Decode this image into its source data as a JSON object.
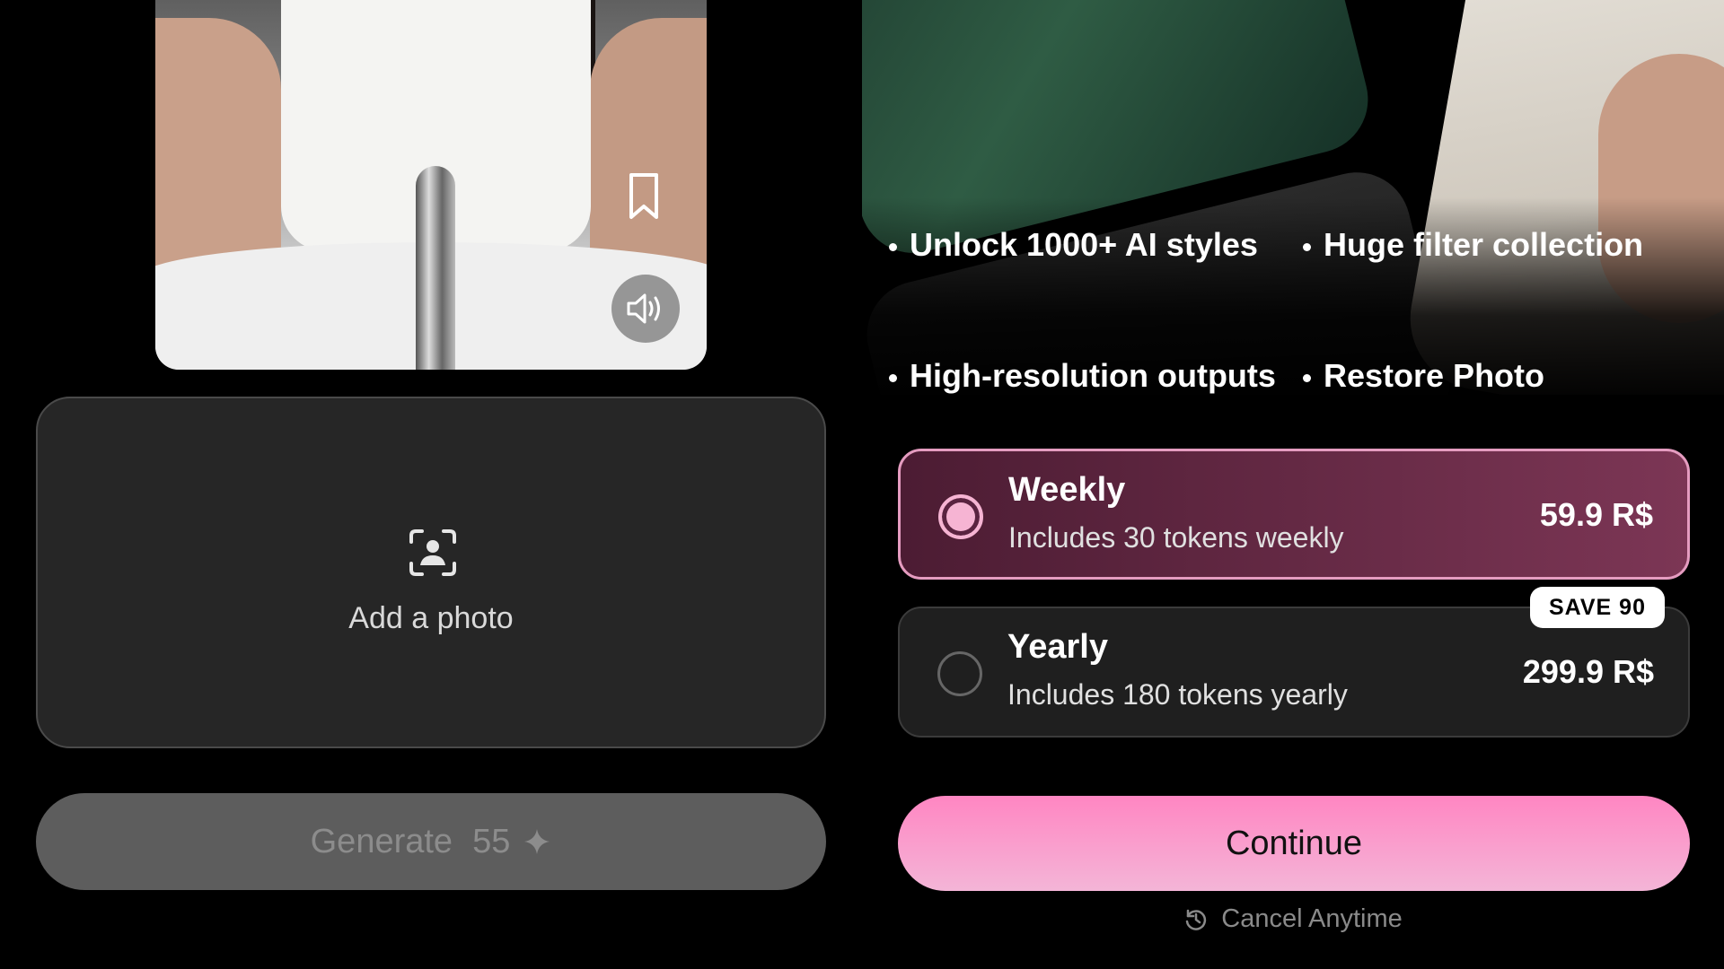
{
  "left": {
    "add_photo_label": "Add a photo",
    "generate_label": "Generate",
    "generate_cost": "55"
  },
  "right": {
    "features": [
      "Unlock 1000+ AI styles",
      "Huge filter collection",
      "High-resolution outputs",
      "Restore Photo"
    ],
    "plans": [
      {
        "name": "Weekly",
        "description": "Includes 30 tokens weekly",
        "price": "59.9 R$",
        "selected": true
      },
      {
        "name": "Yearly",
        "description": "Includes 180 tokens yearly",
        "price": "299.9 R$",
        "selected": false,
        "badge": "SAVE 90"
      }
    ],
    "continue_label": "Continue",
    "cancel_label": "Cancel Anytime"
  },
  "colors": {
    "accent_pink": "#ff86c2",
    "selected_plan": "#7c3655",
    "card_bg": "#262626"
  }
}
